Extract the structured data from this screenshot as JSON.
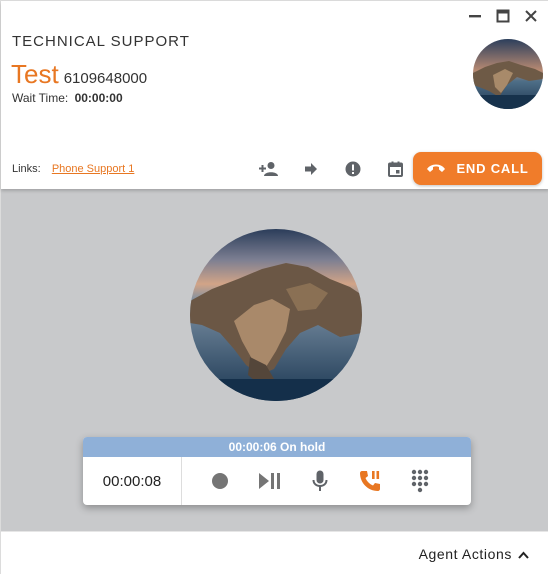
{
  "header": {
    "queue_name": "TECHNICAL SUPPORT",
    "caller_name": "Test",
    "caller_number": "6109648000",
    "wait_label": "Wait Time:",
    "wait_value": "00:00:00",
    "links_label": "Links:",
    "link_text": "Phone Support 1",
    "end_call_label": "END CALL",
    "action_icons": [
      "add-person-icon",
      "forward-arrow-icon",
      "alert-icon",
      "calendar-icon"
    ],
    "window_controls": [
      "minimize-icon",
      "maximize-icon",
      "close-icon"
    ]
  },
  "call_panel": {
    "hold_status": "00:00:06 On hold",
    "timer": "00:00:08",
    "controls": [
      "record-icon",
      "play-pause-icon",
      "microphone-icon",
      "hold-call-icon",
      "dialpad-icon"
    ]
  },
  "footer": {
    "agent_actions_label": "Agent Actions"
  },
  "colors": {
    "accent": "#e87722",
    "end_call": "#f07c2a",
    "hold_bar": "#8fb0d8",
    "main_background": "#c8c9cb",
    "icon_gray": "#5f6368"
  }
}
